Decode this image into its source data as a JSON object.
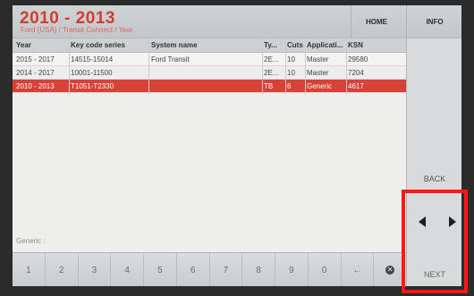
{
  "header": {
    "title": "2010 - 2013",
    "breadcrumb": "Ford (USA) / Transit Connect / Year",
    "home_label": "HOME",
    "info_label": "INFO"
  },
  "table": {
    "columns": [
      "Year",
      "Key code series",
      "System name",
      "Ty...",
      "Cuts",
      "Applicati...",
      "KSN"
    ],
    "rows": [
      [
        "2015 - 2017",
        "14515-15014",
        "Ford Transit",
        "2E...",
        "10",
        "Master",
        "29580"
      ],
      [
        "2014 - 2017",
        "10001-11500",
        "",
        "2E...",
        "10",
        "Master",
        "7204"
      ],
      [
        "2010 - 2013",
        "T1051-T2330",
        "",
        "TB",
        "6",
        "Generic",
        "4617"
      ]
    ]
  },
  "right_panel": {
    "back_label": "BACK",
    "next_label": "NEXT"
  },
  "status_text": "Generic :",
  "keypad": {
    "keys": [
      "1",
      "2",
      "3",
      "4",
      "5",
      "6",
      "7",
      "8",
      "9",
      "0",
      "←"
    ]
  },
  "colors": {
    "accent": "#d84136",
    "highlight": "#ff1616"
  },
  "icons": {
    "left": "arrow-left-icon",
    "right": "arrow-right-icon",
    "delete": "delete-icon"
  }
}
